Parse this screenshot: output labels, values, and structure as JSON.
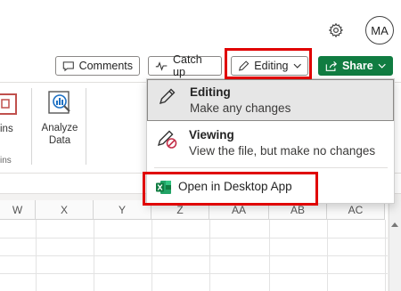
{
  "header": {
    "avatar_initials": "MA",
    "settings_icon": "gear-icon"
  },
  "toolbar": {
    "comments_label": "Comments",
    "catchup_label": "Catch up",
    "editing_label": "Editing",
    "share_label": "Share",
    "share_color": "#107c41"
  },
  "ribbon": {
    "left_partial_label": "ins",
    "left_partial_label2": "ins",
    "analyze_label_line1": "Analyze",
    "analyze_label_line2": "Data"
  },
  "grid": {
    "columns": [
      "W",
      "X",
      "Y",
      "Z",
      "AA",
      "AB",
      "AC"
    ]
  },
  "mode_menu": {
    "items": [
      {
        "title": "Editing",
        "subtitle": "Make any changes",
        "icon": "pencil-icon",
        "selected": true
      },
      {
        "title": "Viewing",
        "subtitle": "View the file, but make no changes",
        "icon": "pencil-no-icon",
        "selected": false
      }
    ],
    "open_desktop_label": "Open in Desktop App",
    "open_desktop_icon": "excel-icon"
  },
  "highlight_color": "#e00000"
}
